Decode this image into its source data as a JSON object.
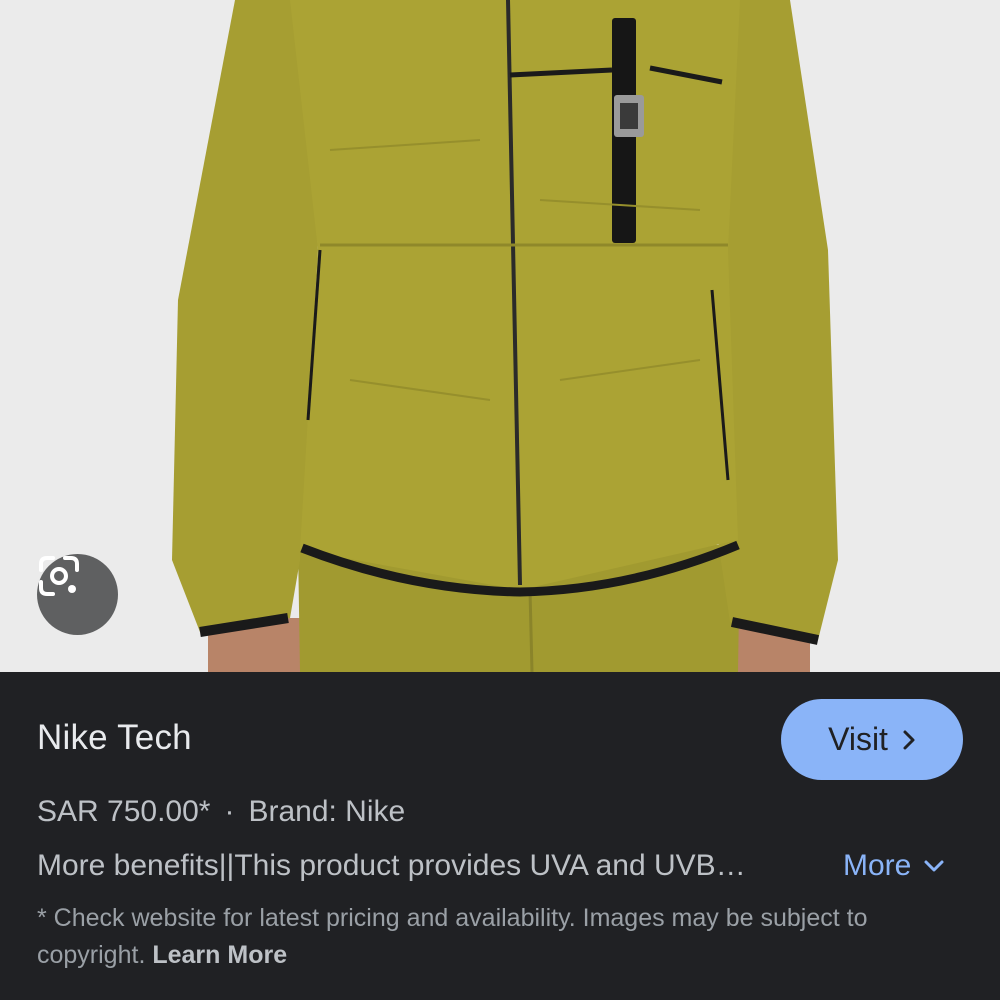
{
  "product": {
    "title": "Nike Tech",
    "price": "SAR 750.00*",
    "separator": "·",
    "brand": "Brand: Nike",
    "description": "More benefits||This product provides UVA and UVB…",
    "image_alt": "olive green Nike Tech woven jacket"
  },
  "actions": {
    "visit_label": "Visit",
    "more_label": "More",
    "lens_icon": "google-lens-icon"
  },
  "disclaimer": {
    "text": "* Check website for latest pricing and availability. Images may be subject to copyright.",
    "link_label": "Learn More"
  },
  "colors": {
    "panel_bg": "#202124",
    "accent": "#8ab4f8",
    "jacket": "#a39b30"
  }
}
